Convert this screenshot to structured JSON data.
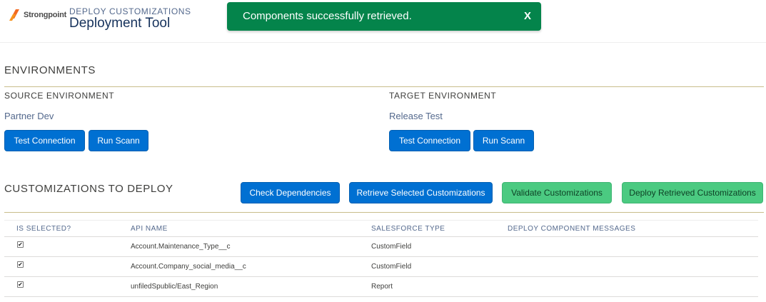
{
  "header": {
    "logo_text": "Strongpoint",
    "eyebrow": "DEPLOY CUSTOMIZATIONS",
    "title": "Deployment Tool"
  },
  "toast": {
    "message": "Components successfully retrieved.",
    "close_label": "X",
    "color": "#04844b"
  },
  "environments": {
    "title": "ENVIRONMENTS",
    "source": {
      "label": "SOURCE ENVIRONMENT",
      "name": "Partner Dev",
      "test_button": "Test Connection",
      "scan_button": "Run Scann"
    },
    "target": {
      "label": "TARGET ENVIRONMENT",
      "name": "Release Test",
      "test_button": "Test Connection",
      "scan_button": "Run Scann"
    }
  },
  "customizations": {
    "title": "CUSTOMIZATIONS TO DEPLOY",
    "buttons": {
      "check": "Check Dependencies",
      "retrieve": "Retrieve Selected Customizations",
      "validate": "Validate Customizations",
      "deploy": "Deploy Retrieved Customizations"
    },
    "columns": [
      "IS SELECTED?",
      "API NAME",
      "SALESFORCE TYPE",
      "DEPLOY COMPONENT MESSAGES"
    ],
    "rows": [
      {
        "selected": true,
        "api_name": "Account.Maintenance_Type__c",
        "type": "CustomField",
        "message": ""
      },
      {
        "selected": true,
        "api_name": "Account.Company_social_media__c",
        "type": "CustomField",
        "message": ""
      },
      {
        "selected": true,
        "api_name": "unfiledSpublic/East_Region",
        "type": "Report",
        "message": ""
      }
    ]
  },
  "colors": {
    "primary_button": "#0070d2",
    "success_button": "#4bca81",
    "divider_gold": "#c9bd8b"
  }
}
